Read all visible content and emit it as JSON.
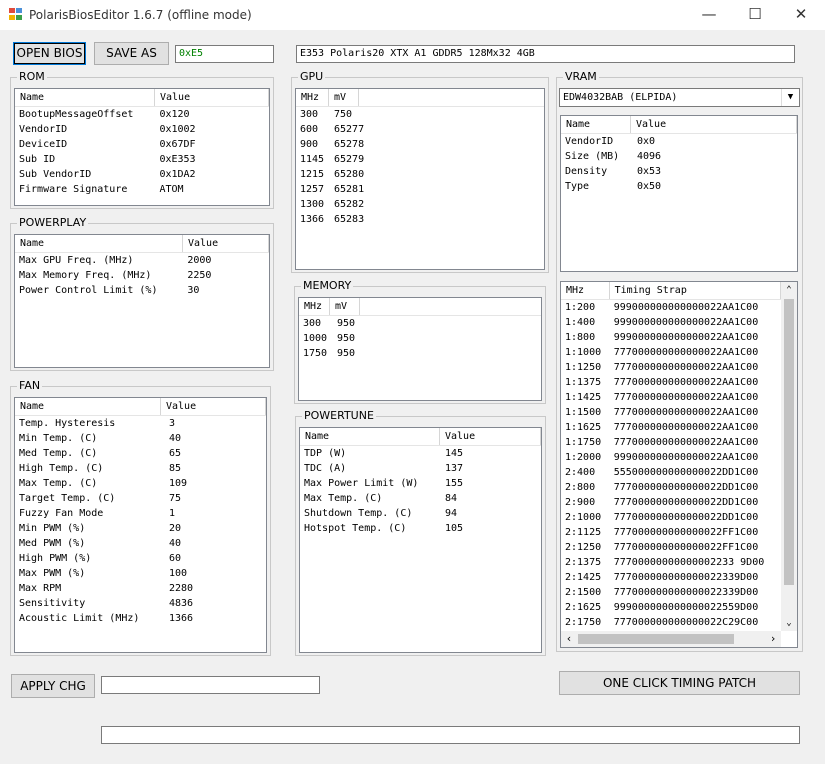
{
  "window": {
    "title": "PolarisBiosEditor 1.6.7 (offline mode)"
  },
  "toolbar": {
    "open_label": "OPEN BIOS",
    "save_label": "SAVE AS",
    "checksum": "0xE5",
    "bios_info": "E353 Polaris20 XTX A1 GDDR5 128Mx32 4GB"
  },
  "rom": {
    "title": "ROM",
    "headers": [
      "Name",
      "Value"
    ],
    "rows": [
      [
        "BootupMessageOffset",
        "0x120"
      ],
      [
        "VendorID",
        "0x1002"
      ],
      [
        "DeviceID",
        "0x67DF"
      ],
      [
        "Sub ID",
        "0xE353"
      ],
      [
        "Sub VendorID",
        "0x1DA2"
      ],
      [
        "Firmware Signature",
        "ATOM"
      ]
    ]
  },
  "powerplay": {
    "title": "POWERPLAY",
    "headers": [
      "Name",
      "Value"
    ],
    "rows": [
      [
        "Max GPU Freq. (MHz)",
        "2000"
      ],
      [
        "Max Memory Freq. (MHz)",
        "2250"
      ],
      [
        "Power Control Limit (%)",
        "30"
      ]
    ]
  },
  "fan": {
    "title": "FAN",
    "headers": [
      "Name",
      "Value"
    ],
    "rows": [
      [
        "Temp. Hysteresis",
        "3"
      ],
      [
        "Min Temp. (C)",
        "40"
      ],
      [
        "Med Temp. (C)",
        "65"
      ],
      [
        "High Temp. (C)",
        "85"
      ],
      [
        "Max Temp. (C)",
        "109"
      ],
      [
        "Target Temp. (C)",
        "75"
      ],
      [
        "Fuzzy Fan Mode",
        "1"
      ],
      [
        "Min PWM (%)",
        "20"
      ],
      [
        "Med PWM (%)",
        "40"
      ],
      [
        "High PWM (%)",
        "60"
      ],
      [
        "Max PWM (%)",
        "100"
      ],
      [
        "Max RPM",
        "2280"
      ],
      [
        "Sensitivity",
        "4836"
      ],
      [
        "Acoustic Limit (MHz)",
        "1366"
      ]
    ]
  },
  "gpu": {
    "title": "GPU",
    "headers": [
      "MHz",
      "mV"
    ],
    "rows": [
      [
        "300",
        "750"
      ],
      [
        "600",
        "65277"
      ],
      [
        "900",
        "65278"
      ],
      [
        "1145",
        "65279"
      ],
      [
        "1215",
        "65280"
      ],
      [
        "1257",
        "65281"
      ],
      [
        "1300",
        "65282"
      ],
      [
        "1366",
        "65283"
      ]
    ]
  },
  "memory": {
    "title": "MEMORY",
    "headers": [
      "MHz",
      "mV"
    ],
    "rows": [
      [
        "300",
        "950"
      ],
      [
        "1000",
        "950"
      ],
      [
        "1750",
        "950"
      ]
    ]
  },
  "powertune": {
    "title": "POWERTUNE",
    "headers": [
      "Name",
      "Value"
    ],
    "rows": [
      [
        "TDP (W)",
        "145"
      ],
      [
        "TDC (A)",
        "137"
      ],
      [
        "Max Power Limit (W)",
        "155"
      ],
      [
        "Max Temp. (C)",
        "84"
      ],
      [
        "Shutdown Temp. (C)",
        "94"
      ],
      [
        "Hotspot Temp. (C)",
        "105"
      ]
    ]
  },
  "vram": {
    "title": "VRAM",
    "selected": "EDW4032BAB (ELPIDA)",
    "headers": [
      "Name",
      "Value"
    ],
    "rows": [
      [
        "VendorID",
        "0x0"
      ],
      [
        "Size (MB)",
        "4096"
      ],
      [
        "Density",
        "0x53"
      ],
      [
        "Type",
        "0x50"
      ]
    ],
    "timing_headers": [
      "MHz",
      "Timing Strap"
    ],
    "timings": [
      [
        "1:200",
        "999000000000000022AA1C00"
      ],
      [
        "1:400",
        "999000000000000022AA1C00"
      ],
      [
        "1:800",
        "999000000000000022AA1C00"
      ],
      [
        "1:1000",
        "777000000000000022AA1C00"
      ],
      [
        "1:1250",
        "777000000000000022AA1C00"
      ],
      [
        "1:1375",
        "777000000000000022AA1C00"
      ],
      [
        "1:1425",
        "777000000000000022AA1C00"
      ],
      [
        "1:1500",
        "777000000000000022AA1C00"
      ],
      [
        "1:1625",
        "777000000000000022AA1C00"
      ],
      [
        "1:1750",
        "777000000000000022AA1C00"
      ],
      [
        "1:2000",
        "999000000000000022AA1C00"
      ],
      [
        "2:400",
        "555000000000000022DD1C00"
      ],
      [
        "2:800",
        "777000000000000022DD1C00"
      ],
      [
        "2:900",
        "777000000000000022DD1C00"
      ],
      [
        "2:1000",
        "777000000000000022DD1C00"
      ],
      [
        "2:1125",
        "777000000000000022FF1C00"
      ],
      [
        "2:1250",
        "777000000000000022FF1C00"
      ],
      [
        "2:1375",
        "77700000000000002233 9D00"
      ],
      [
        "2:1425",
        "777000000000000022339D00"
      ],
      [
        "2:1500",
        "777000000000000022339D00"
      ],
      [
        "2:1625",
        "999000000000000022559D00"
      ],
      [
        "2:1750",
        "777000000000000022C29C00"
      ]
    ]
  },
  "bottom": {
    "apply_label": "APPLY CHG",
    "timing_patch_label": "ONE CLICK TIMING PATCH"
  }
}
